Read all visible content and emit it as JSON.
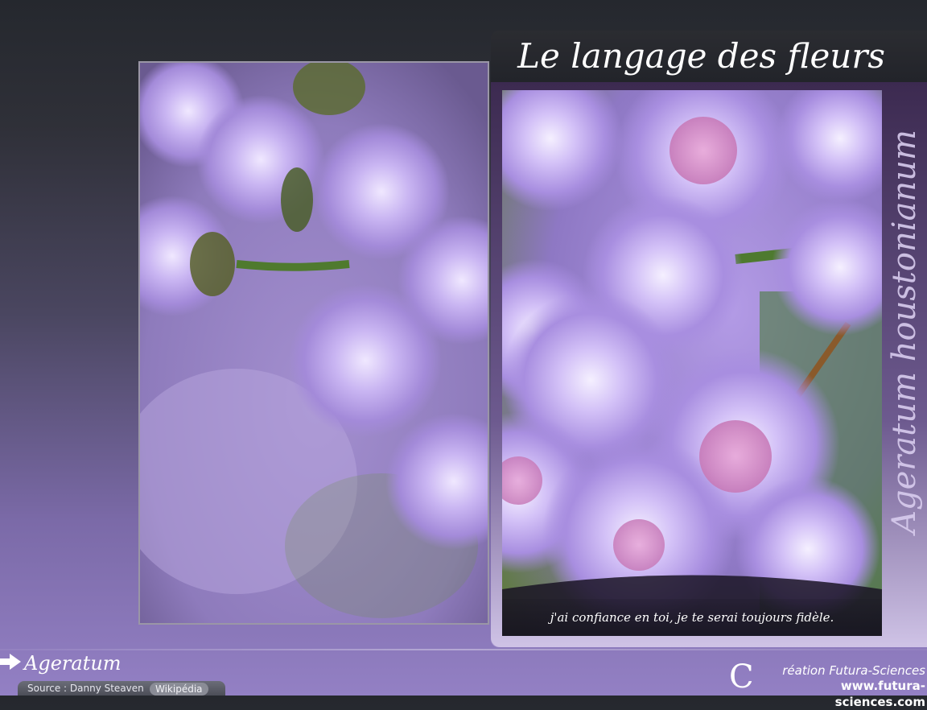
{
  "header": {
    "title": "Le langage des fleurs"
  },
  "flower": {
    "common_name": "Ageratum",
    "latin_name": "Ageratum houstonianum",
    "meaning": "j'ai confiance en toi, je te serai toujours fidèle."
  },
  "footer": {
    "source": "Source : Danny Steaven",
    "source_badge": "Wikipédia",
    "credit_line1": "réation Futura-Sciences",
    "credit_line2": "www.futura-sciences.com",
    "credit_mark": "C"
  },
  "icons": {
    "arrow": "arrow-right-icon",
    "flowers": "ageratum-photo"
  },
  "colors": {
    "flower_petal": "#c9b3f0",
    "flower_center": "#d884c6",
    "stem": "#4e7a2f",
    "background_purple": "#9380c4"
  }
}
